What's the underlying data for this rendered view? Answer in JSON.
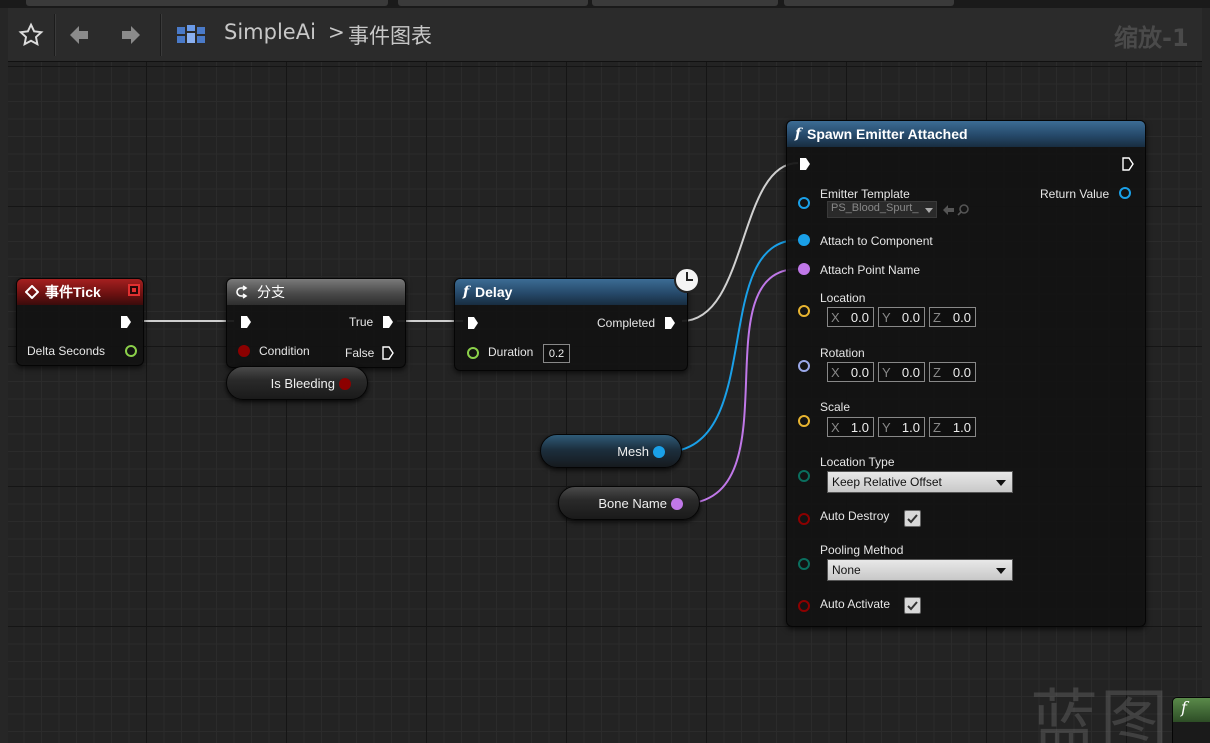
{
  "toolbar": {
    "breadcrumb_root": "SimpleAi",
    "breadcrumb_separator": ">",
    "breadcrumb_current": "事件图表",
    "zoom": "缩放-1"
  },
  "icons": {
    "favorite": "star-icon",
    "back": "arrow-left-icon",
    "forward": "arrow-right-icon",
    "blueprint": "blueprint-grid-icon",
    "function": "f",
    "latent": "clock-icon"
  },
  "nodes": {
    "event_tick": {
      "title": "事件Tick",
      "output_delta": "Delta Seconds"
    },
    "branch": {
      "title": "分支",
      "input_condition": "Condition",
      "output_true": "True",
      "output_false": "False"
    },
    "is_bleeding": {
      "label": "Is Bleeding"
    },
    "delay": {
      "title": "Delay",
      "input_duration": "Duration",
      "duration_value": "0.2",
      "output_completed": "Completed"
    },
    "mesh": {
      "label": "Mesh"
    },
    "bone_name": {
      "label": "Bone Name"
    },
    "spawn_emitter": {
      "title": "Spawn Emitter Attached",
      "emitter_template_label": "Emitter Template",
      "emitter_template_value": "PS_Blood_Spurt_",
      "return_value": "Return Value",
      "attach_component": "Attach to Component",
      "attach_point": "Attach Point Name",
      "location_label": "Location",
      "location": {
        "x": "0.0",
        "y": "0.0",
        "z": "0.0"
      },
      "rotation_label": "Rotation",
      "rotation": {
        "x": "0.0",
        "y": "0.0",
        "z": "0.0"
      },
      "scale_label": "Scale",
      "scale": {
        "x": "1.0",
        "y": "1.0",
        "z": "1.0"
      },
      "location_type_label": "Location Type",
      "location_type_value": "Keep Relative Offset",
      "auto_destroy_label": "Auto Destroy",
      "auto_destroy": true,
      "pooling_method_label": "Pooling Method",
      "pooling_method_value": "None",
      "auto_activate_label": "Auto Activate",
      "auto_activate": true
    }
  },
  "axis_labels": {
    "x": "X",
    "y": "Y",
    "z": "Z"
  },
  "watermark": "蓝图",
  "colors": {
    "exec_wire": "#d8d8d8",
    "bool_pin": "#8c0000",
    "float_pin": "#8bd04a",
    "object_pin": "#1aa0e8",
    "name_pin": "#c078e8",
    "vector_pin": "#e8b430",
    "rotator_pin": "#9aa8e8",
    "enum_pin": "#0a6e5e"
  }
}
